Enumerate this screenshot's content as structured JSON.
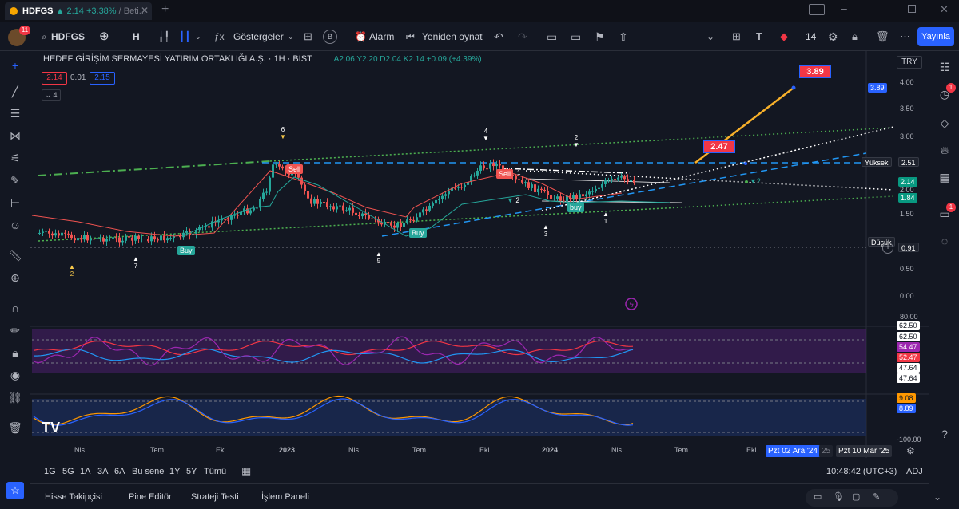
{
  "tab": {
    "symbol": "HDFGS",
    "change": "▲ 2.14 +3.38%",
    "rest": "/ Beti..."
  },
  "toolbar": {
    "avatar_badge": "11",
    "symbol": "HDFGS",
    "interval": "H",
    "indicators_label": "Göstergeler",
    "alert_label": "Alarm",
    "replay_label": "Yeniden oynat",
    "font_size": "14",
    "publish_label": "Yayınla"
  },
  "legend": {
    "title": "HEDEF GİRİŞİM SERMAYESİ YATIRIM ORTAKLIĞI A.Ş. · 1H · BIST",
    "ohlc": "A2.06 Y2.20 D2.04 K2.14 +0.09 (+4.39%)",
    "bid": "2.14",
    "spread": "0.01",
    "ask": "2.15",
    "indicator_count": "4"
  },
  "currency": "TRY",
  "price_axis": {
    "ticks": [
      "4.00",
      "3.50",
      "3.00",
      "2.50",
      "2.00",
      "1.50",
      "1.00",
      "0.50",
      "0.00"
    ],
    "labels": [
      {
        "text": "3.89",
        "color": "#2962ff"
      },
      {
        "text": "Yüksek",
        "color": "#1e222d"
      },
      {
        "text": "2.51",
        "color": "#1e222d"
      },
      {
        "text": "2.14",
        "color": "#089981"
      },
      {
        "text": "1.84",
        "color": "#089981"
      },
      {
        "text": "Düşük",
        "color": "#1e222d"
      },
      {
        "text": "0.91",
        "color": "#1e222d"
      }
    ]
  },
  "rsi_axis": {
    "ticks": [
      "80.00"
    ],
    "labels": [
      {
        "text": "62.50",
        "color": "#ffffff"
      },
      {
        "text": "62.50",
        "color": "#ffffff"
      },
      {
        "text": "54.47",
        "color": "#9c27b0"
      },
      {
        "text": "52.47",
        "color": "#f23645"
      },
      {
        "text": "47.64",
        "color": "#ffffff"
      },
      {
        "text": "47.64",
        "color": "#ffffff"
      }
    ]
  },
  "macd_axis": {
    "ticks": [
      "-100.00"
    ],
    "labels": [
      {
        "text": "9.08",
        "color": "#ff9800"
      },
      {
        "text": "8.89",
        "color": "#2962ff"
      }
    ]
  },
  "time_axis": [
    "Nis",
    "Tem",
    "Eki",
    "2023",
    "Nis",
    "Tem",
    "Eki",
    "2024",
    "Nis",
    "Tem",
    "Eki"
  ],
  "time_markers": [
    "Pzt 02 Ara '24",
    "Pzt 10 Mar '25"
  ],
  "time_marker_fragment": "25",
  "annotations": {
    "target_high": "3.89",
    "target_mid": "2.47",
    "sell1": "Sell",
    "sell2": "Sell",
    "buy1": "Buy",
    "buy2": "Buy",
    "buy3": "buy",
    "wave_labels": [
      "6",
      "7",
      "5",
      "4",
      "3",
      "2",
      "1",
      "2",
      "2",
      "1",
      "2"
    ]
  },
  "bottom": {
    "ranges": [
      "1G",
      "5G",
      "1A",
      "3A",
      "6A",
      "Bu sene",
      "1Y",
      "5Y",
      "Tümü"
    ],
    "clock": "10:48:42 (UTC+3)",
    "adj": "ADJ"
  },
  "panels": [
    "Hisse Takipçisi",
    "Pine Editör",
    "Strateji Testi",
    "İşlem Paneli"
  ],
  "colors": {
    "up": "#26a69a",
    "down": "#ef5350",
    "accent": "#2962ff",
    "bg": "#131722"
  }
}
